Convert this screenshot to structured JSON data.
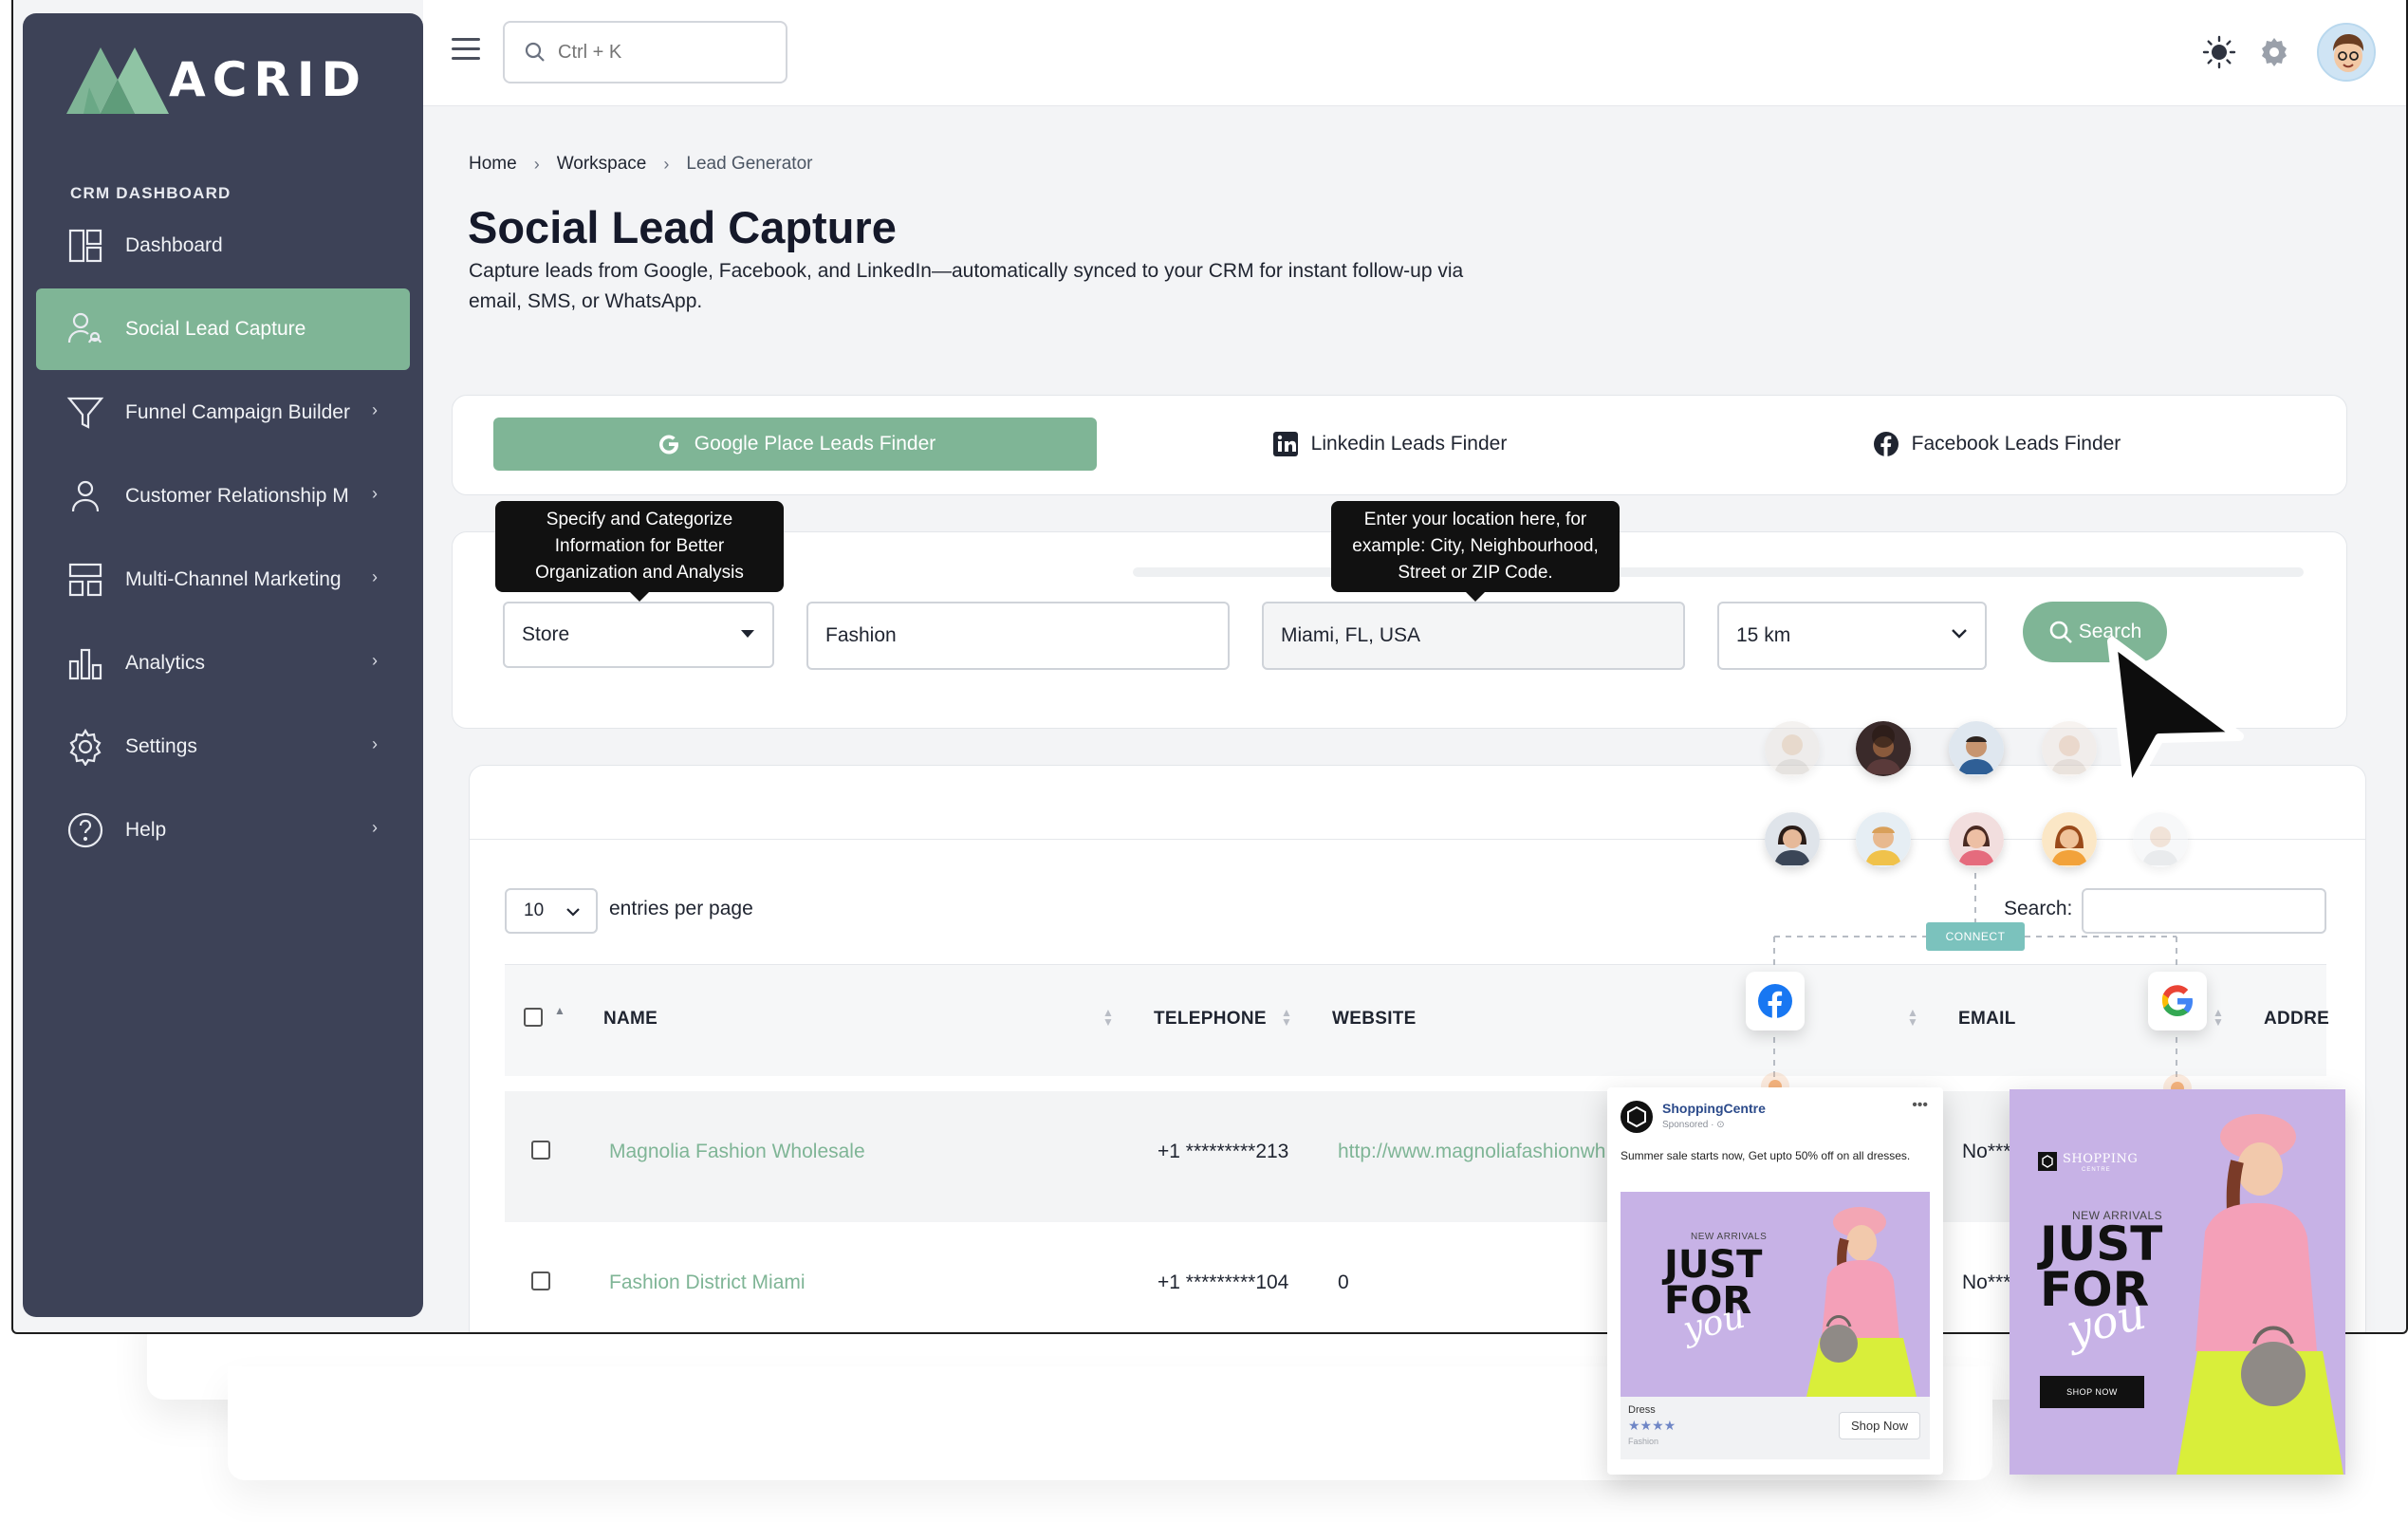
{
  "sidebar": {
    "brand": "ACRID",
    "section_title": "CRM DASHBOARD",
    "items": [
      {
        "label": "Dashboard",
        "icon": "dashboard-icon"
      },
      {
        "label": "Social Lead Capture",
        "icon": "user-network-icon"
      },
      {
        "label": "Funnel Campaign Builder",
        "icon": "funnel-icon"
      },
      {
        "label": "Customer Relationship M",
        "icon": "user-icon"
      },
      {
        "label": "Multi-Channel Marketing",
        "icon": "layout-icon"
      },
      {
        "label": "Analytics",
        "icon": "bar-chart-icon"
      },
      {
        "label": "Settings",
        "icon": "gear-icon"
      },
      {
        "label": "Help",
        "icon": "help-icon"
      }
    ],
    "active_index": 1
  },
  "topbar": {
    "search_placeholder": "Ctrl + K"
  },
  "breadcrumb": [
    "Home",
    "Workspace",
    "Lead Generator"
  ],
  "page": {
    "title": "Social Lead Capture",
    "description": "Capture leads from Google, Facebook, and LinkedIn—automatically synced to your CRM for instant follow-up via email, SMS, or WhatsApp."
  },
  "tabs": [
    {
      "label": "Google Place Leads Finder",
      "active": true
    },
    {
      "label": "Linkedin Leads Finder",
      "active": false
    },
    {
      "label": "Facebook Leads Finder",
      "active": false
    }
  ],
  "filters": {
    "tooltip_category": "Specify and Categorize Information for Better Organization and Analysis",
    "tooltip_location": "Enter your location here, for example: City, Neighbourhood, Street or ZIP Code.",
    "category_value": "Store",
    "keyword_value": "Fashion",
    "location_value": "Miami, FL, USA",
    "radius_value": "15 km",
    "search_button": "Search"
  },
  "table": {
    "entries_value": "10",
    "entries_label": "entries per page",
    "search_label": "Search:",
    "columns": [
      "NAME",
      "TELEPHONE",
      "WEBSITE",
      "EMAIL",
      "ADDRE"
    ],
    "rows": [
      {
        "name": "Magnolia Fashion Wholesale",
        "telephone": "+1 *********213",
        "website": "http://www.magnoliafashionwh",
        "email": "No***"
      },
      {
        "name": "Fashion District Miami",
        "telephone": "+1 *********104",
        "website": "0",
        "email": "No***"
      }
    ]
  },
  "promo": {
    "connect_label": "CONNECT",
    "fb_ad": {
      "page_name": "ShoppingCentre",
      "sponsored": "Sponsored · ⊙",
      "text": "Summer sale starts now, Get upto 50% off on all dresses.",
      "new_arrivals": "NEW ARRIVALS",
      "headline_1": "JUST",
      "headline_2": "FOR",
      "headline_3": "you",
      "product": "Dress",
      "category": "Fashion",
      "rating": "★★★★",
      "cta": "Shop Now"
    },
    "story_ad": {
      "brand_1": "SHOPPING",
      "brand_2": "CENTRE",
      "new_arrivals": "NEW ARRIVALS",
      "headline_1": "JUST",
      "headline_2": "FOR",
      "headline_3": "you",
      "cta": "SHOP NOW"
    }
  },
  "colors": {
    "sidebar_bg": "#3d4257",
    "accent": "#7fb596",
    "text_dark": "#15192a",
    "ad_purple": "#c7b2e6"
  }
}
